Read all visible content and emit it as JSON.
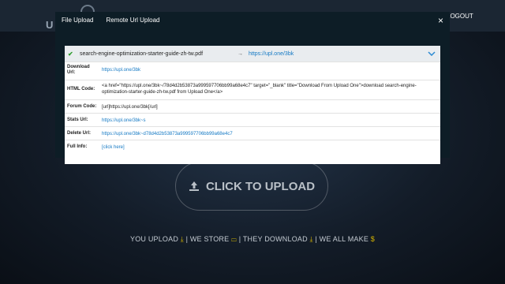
{
  "site": {
    "logo_text": "U",
    "logout_label": "LOGOUT",
    "upload_button_label": "CLICK TO UPLOAD",
    "tagline": [
      {
        "text": "YOU UPLOAD",
        "icon": "download-icon"
      },
      {
        "text": "| WE STORE",
        "icon": "storage-icon"
      },
      {
        "text": "| THEY DOWNLOAD",
        "icon": "download-icon"
      },
      {
        "text": "| WE ALL MAKE",
        "icon": "dollar-icon"
      }
    ]
  },
  "modal": {
    "tabs": [
      "File Upload",
      "Remote Url Upload"
    ],
    "close_glyph": "×",
    "file": {
      "name": "search-engine-optimization-starter-guide-zh-tw.pdf",
      "arrow": "→",
      "url": "https://upl.one/3bk"
    },
    "info": [
      {
        "label": "Download Url:",
        "value": "https://upl.one/3bk",
        "link": true
      },
      {
        "label": "HTML Code:",
        "value": "<a href=\"https://upl.one/3bk~/78d4d2b53873a999597706bb99a68e4c7\" target=\"_blank\" title=\"Download From Upload One\">download search-engine-optimization-starter-guide-zh-tw.pdf from Upload One</a>",
        "link": false
      },
      {
        "label": "Forum Code:",
        "value": "[url]https://upl.one/3bk[/url]",
        "link": false
      },
      {
        "label": "Stats Url:",
        "value": "https://upl.one/3bk~s",
        "link": true
      },
      {
        "label": "Delete Url:",
        "value": "https://upl.one/3bk~d78d4d2b53873a999597706bb99a68e4c7",
        "link": true
      },
      {
        "label": "Full Info:",
        "value": "[click here]",
        "link": true
      }
    ]
  }
}
